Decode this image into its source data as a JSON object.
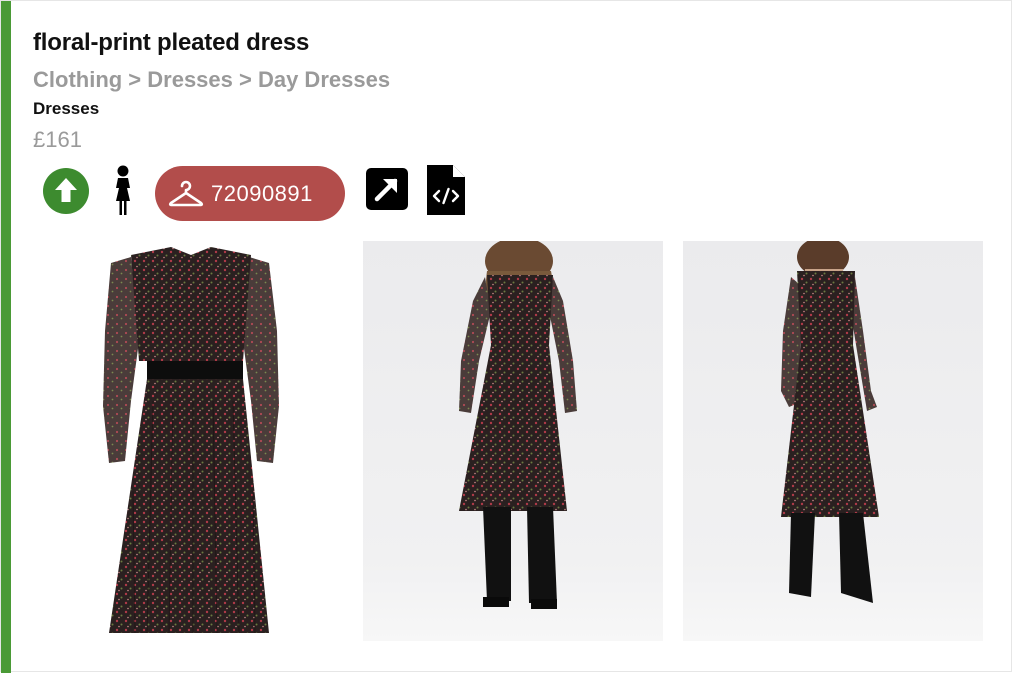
{
  "product": {
    "title": "floral-print pleated dress",
    "breadcrumb": "Clothing > Dresses > Day Dresses",
    "category": "Dresses",
    "price": "£161"
  },
  "actions": {
    "upvote_icon": "arrow-up-circle-icon",
    "gender_icon": "woman-icon",
    "product_id": "72090891",
    "product_id_icon": "hanger-icon",
    "open_icon": "external-link-arrow-icon",
    "code_icon": "code-file-icon"
  },
  "colors": {
    "accent": "#4a9a36",
    "upvote": "#3d8b2f",
    "id_pill": "#b24d4b",
    "muted_text": "#9a9a9a"
  },
  "images": [
    {
      "name": "front-view"
    },
    {
      "name": "back-view"
    },
    {
      "name": "side-view"
    }
  ]
}
